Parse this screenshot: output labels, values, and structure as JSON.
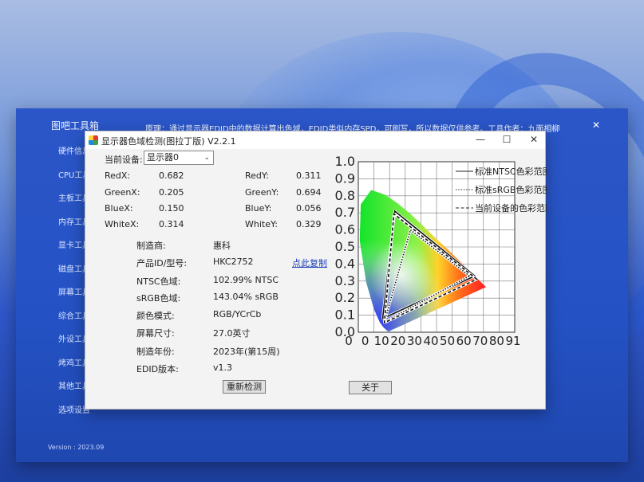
{
  "host": {
    "title": "图吧工具箱",
    "info": "原理：通过显示器EDID中的数据计算出色域，EDID类似内存SPD，可刷写，所以数据仅供参考。工具作者：九面相柳",
    "close": "✕",
    "menu": [
      "硬件信息",
      "CPU工具",
      "主板工具",
      "内存工具",
      "显卡工具",
      "磁盘工具",
      "屏幕工具",
      "综合工具",
      "外设工具",
      "烤鸡工具",
      "其他工具",
      "选项设置"
    ],
    "version": "Version : 2023.09"
  },
  "dialog": {
    "title": "显示器色域检测(图拉丁版) V2.2.1",
    "min": "—",
    "max": "☐",
    "close": "✕",
    "device_label": "当前设备:",
    "device_value": "显示器0",
    "coords": {
      "redx_label": "RedX:",
      "redx": "0.682",
      "redy_label": "RedY:",
      "redy": "0.311",
      "greenx_label": "GreenX:",
      "greenx": "0.205",
      "greeny_label": "GreenY:",
      "greeny": "0.694",
      "bluex_label": "BlueX:",
      "bluex": "0.150",
      "bluey_label": "BlueY:",
      "bluey": "0.056",
      "whitex_label": "WhiteX:",
      "whitex": "0.314",
      "whitey_label": "WhiteY:",
      "whitey": "0.329"
    },
    "info": {
      "maker_label": "制造商:",
      "maker": "惠科",
      "product_label": "产品ID/型号:",
      "product": "HKC2752",
      "copy_link": "点此复制",
      "ntsc_label": "NTSC色域:",
      "ntsc": "102.99% NTSC",
      "srgb_label": "sRGB色域:",
      "srgb": "143.04% sRGB",
      "color_label": "颜色模式:",
      "color": "RGB/YCrCb",
      "size_label": "屏幕尺寸:",
      "size": "27.0英寸",
      "year_label": "制造年份:",
      "year": "2023年(第15周)",
      "edid_label": "EDID版本:",
      "edid": "v1.3"
    },
    "buttons": {
      "redetect": "重新检测",
      "about": "关于"
    }
  },
  "chart_data": {
    "type": "scatter",
    "xlim": [
      0,
      0.9
    ],
    "ylim": [
      0,
      1.0
    ],
    "xticks": [
      "0",
      "0",
      "10",
      "20",
      "30",
      "40",
      "50",
      "60",
      "70",
      "80",
      "91"
    ],
    "yticks": [
      "1.0",
      "0.9",
      "0.8",
      "0.7",
      "0.6",
      "0.5",
      "0.4",
      "0.3",
      "0.2",
      "0.1",
      "0.0"
    ],
    "grid": true,
    "legend_position": "top-right",
    "series": [
      {
        "name": "标准NTSC色彩范围",
        "points": [
          [
            0.67,
            0.33
          ],
          [
            0.21,
            0.71
          ],
          [
            0.14,
            0.08
          ]
        ],
        "style": "solid"
      },
      {
        "name": "标准sRGB色彩范围",
        "points": [
          [
            0.64,
            0.33
          ],
          [
            0.3,
            0.6
          ],
          [
            0.15,
            0.06
          ]
        ],
        "style": "dotted"
      },
      {
        "name": "当前设备的色彩范围",
        "points": [
          [
            0.682,
            0.311
          ],
          [
            0.205,
            0.694
          ],
          [
            0.15,
            0.056
          ]
        ],
        "style": "dashed"
      }
    ],
    "locus": [
      [
        0.175,
        0.005
      ],
      [
        0.174,
        0.005
      ],
      [
        0.172,
        0.005
      ],
      [
        0.166,
        0.009
      ],
      [
        0.144,
        0.03
      ],
      [
        0.124,
        0.058
      ],
      [
        0.091,
        0.133
      ],
      [
        0.045,
        0.295
      ],
      [
        0.008,
        0.538
      ],
      [
        0.014,
        0.75
      ],
      [
        0.074,
        0.834
      ],
      [
        0.155,
        0.806
      ],
      [
        0.229,
        0.754
      ],
      [
        0.302,
        0.692
      ],
      [
        0.373,
        0.624
      ],
      [
        0.441,
        0.555
      ],
      [
        0.513,
        0.487
      ],
      [
        0.576,
        0.424
      ],
      [
        0.627,
        0.373
      ],
      [
        0.666,
        0.334
      ],
      [
        0.692,
        0.308
      ],
      [
        0.735,
        0.265
      ]
    ]
  }
}
